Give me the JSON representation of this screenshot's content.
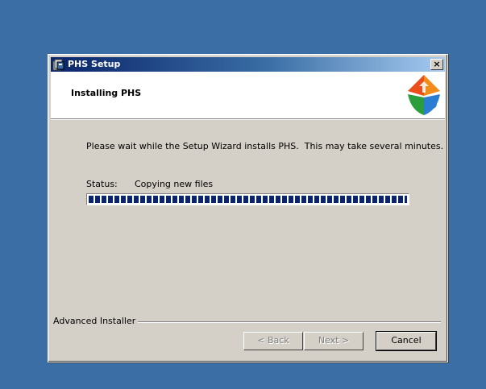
{
  "window": {
    "title": "PHS Setup",
    "close_label": "×"
  },
  "banner": {
    "title": "Installing PHS",
    "logo_icon": "installer-puzzle-logo"
  },
  "body": {
    "description": "Please wait while the Setup Wizard installs PHS.  This may take several minutes.",
    "status_label": "Status:",
    "status_value": "Copying new files",
    "progress_fraction": 1.0
  },
  "footer": {
    "brand": "Advanced Installer",
    "back_label": "< Back",
    "next_label": "Next >",
    "cancel_label": "Cancel"
  },
  "colors": {
    "desktop": "#3a6ea5",
    "dialog": "#d4d0c8",
    "progress": "#0a246a"
  }
}
